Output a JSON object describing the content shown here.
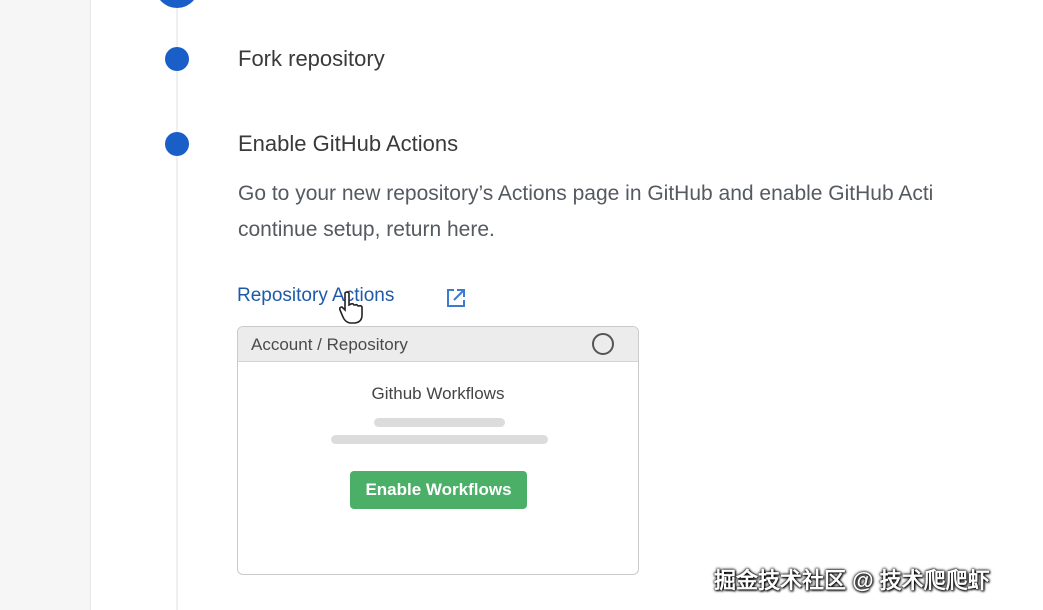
{
  "steps": [
    {
      "title": "Fork repository"
    },
    {
      "title": "Enable GitHub Actions",
      "description_line1": "Go to your new repository’s Actions page in GitHub and enable GitHub Acti",
      "description_line2": "continue setup, return here."
    }
  ],
  "link": {
    "label": "Repository Actions",
    "icon": "external-link-icon"
  },
  "window": {
    "header_label": "Account / Repository",
    "title": "Github Workflows",
    "button_label": "Enable Workflows"
  },
  "watermark": "掘金技术社区 @ 技术爬爬虾",
  "colors": {
    "accent": "#1a5fc8",
    "link": "#1e5aa8",
    "button_green": "#4caf68"
  }
}
